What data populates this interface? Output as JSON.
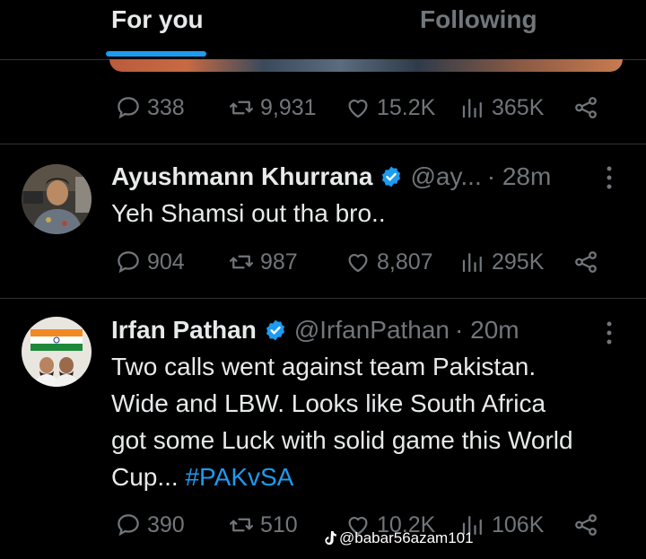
{
  "tabs": [
    {
      "label": "For you",
      "active": true
    },
    {
      "label": "Following",
      "active": false
    }
  ],
  "top_actions": {
    "replies": "338",
    "reposts": "9,931",
    "likes": "15.2K",
    "views": "365K"
  },
  "tweets": [
    {
      "name": "Ayushmann Khurrana",
      "handle": "@ay...",
      "time": "· 28m",
      "text": "Yeh Shamsi out tha bro..",
      "actions": {
        "replies": "904",
        "reposts": "987",
        "likes": "8,807",
        "views": "295K"
      }
    },
    {
      "name": "Irfan Pathan",
      "handle": "@IrfanPathan",
      "time": "· 20m",
      "text_lines": [
        "Two calls went against team Pakistan.",
        "Wide and LBW.  Looks like South Africa",
        "got some Luck with solid game this World"
      ],
      "last_line": "Cup... ",
      "hashtag": "#PAKvSA",
      "actions": {
        "replies": "390",
        "reposts": "510",
        "likes": "10.2K",
        "views": "106K"
      }
    }
  ],
  "watermark": "@babar56azam101",
  "colors": {
    "background": "#000000",
    "text": "#e7e9ea",
    "muted": "#71767b",
    "accent": "#1d9bf0",
    "divider": "#2f3336"
  },
  "icons": [
    "reply-icon",
    "repost-icon",
    "like-icon",
    "views-icon",
    "share-icon",
    "verified-icon",
    "more-icon",
    "tiktok-icon"
  ]
}
